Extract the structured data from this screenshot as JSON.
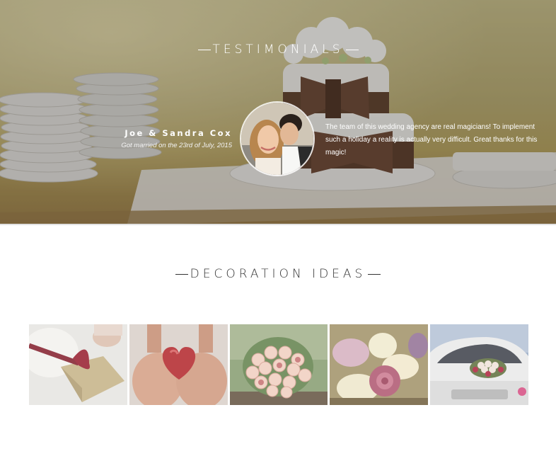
{
  "testimonials": {
    "title": "TESTIMONIALS",
    "author_name": "Joe & Sandra Cox",
    "author_subtitle": "Got married on the 23rd of July, 2015",
    "quote": "The team of this wedding agency are real magicians! To implement such a holiday a reality is actually very difficult. Great thanks for this magic!"
  },
  "decoration": {
    "title": "DECORATION IDEAS",
    "items": [
      {
        "subject": "ribbon-card"
      },
      {
        "subject": "heart-in-hands"
      },
      {
        "subject": "rose-bouquet"
      },
      {
        "subject": "rose-lily-flowers"
      },
      {
        "subject": "wedding-limousine"
      }
    ]
  }
}
